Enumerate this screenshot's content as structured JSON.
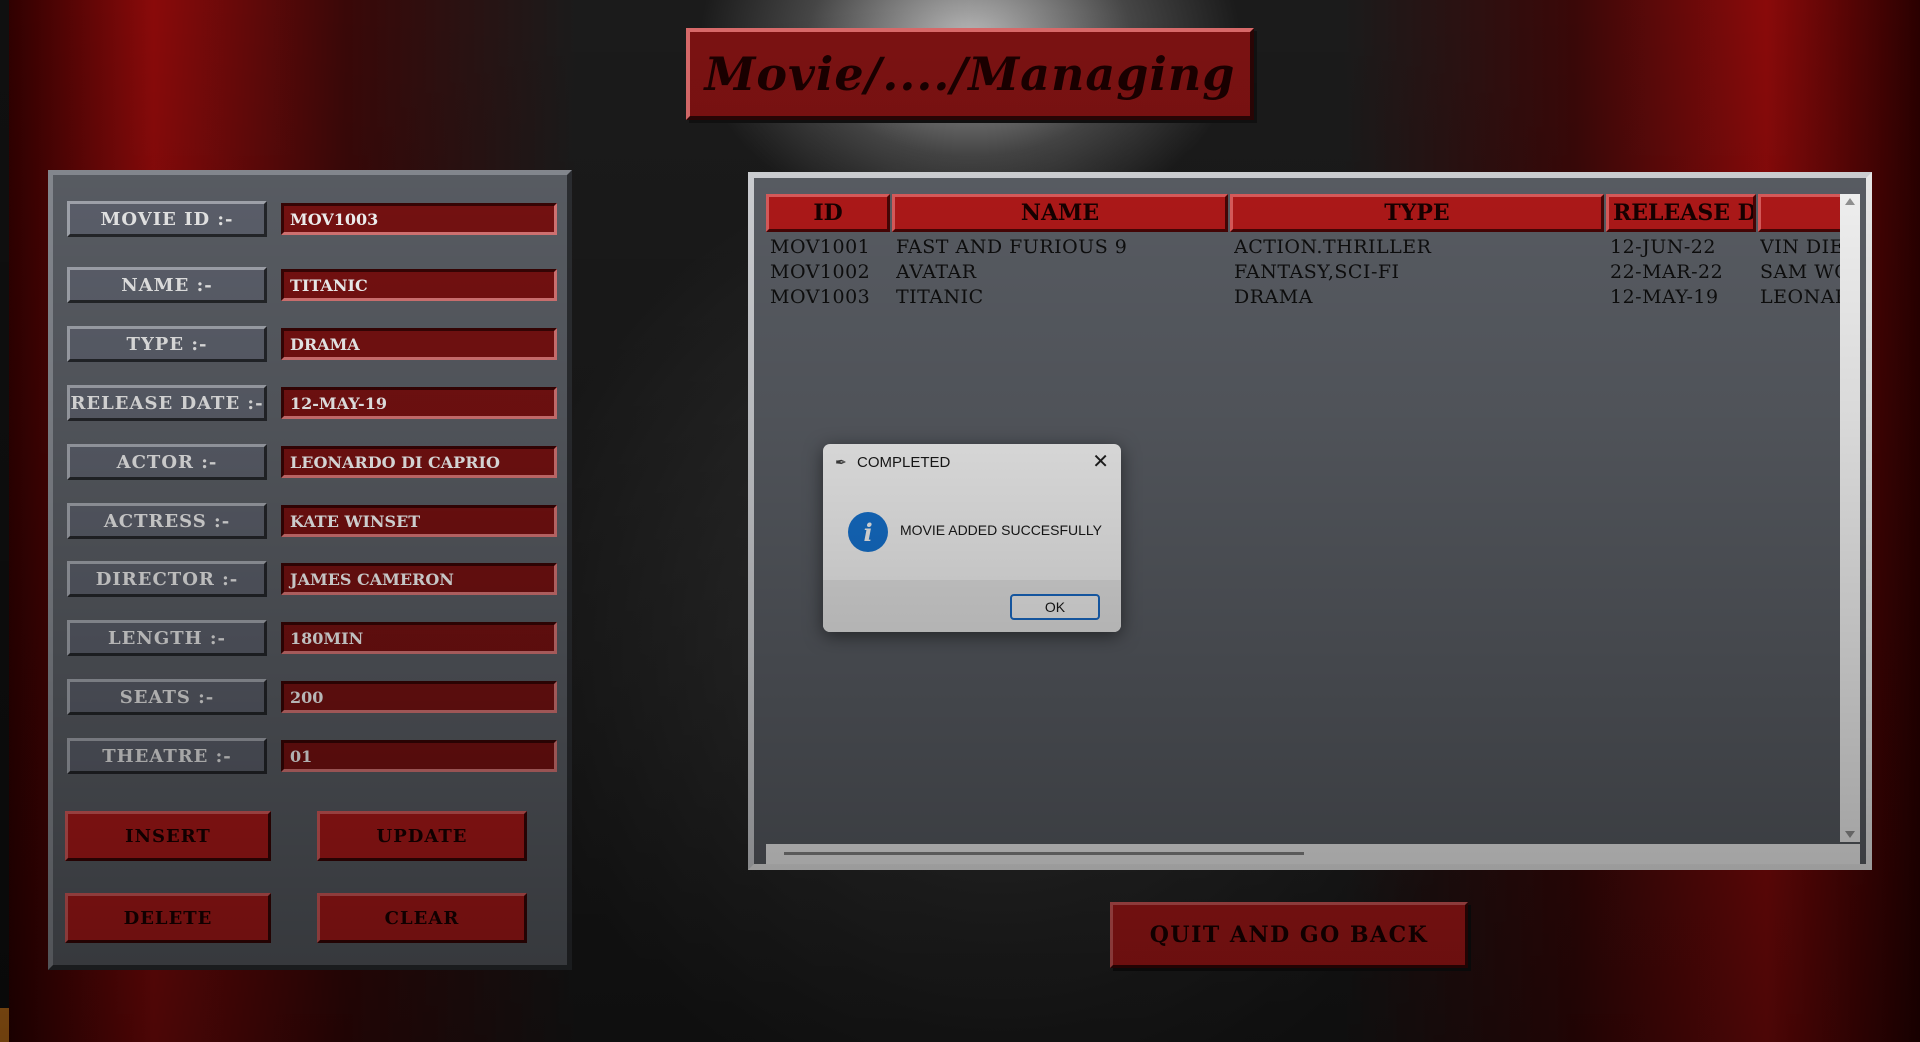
{
  "title": "Movie/..../Managing",
  "form": {
    "fields": [
      {
        "label": "MOVIE ID :-",
        "value": "MOV1003"
      },
      {
        "label": "NAME :-",
        "value": "TITANIC"
      },
      {
        "label": "TYPE :-",
        "value": "DRAMA"
      },
      {
        "label": "RELEASE DATE :-",
        "value": "12-MAY-19"
      },
      {
        "label": "ACTOR :-",
        "value": "LEONARDO DI CAPRIO"
      },
      {
        "label": "ACTRESS :-",
        "value": "KATE WINSET"
      },
      {
        "label": "DIRECTOR :-",
        "value": "JAMES CAMERON"
      },
      {
        "label": "LENGTH :-",
        "value": "180MIN"
      },
      {
        "label": "SEATS :-",
        "value": "200"
      },
      {
        "label": "THEATRE :-",
        "value": "01"
      }
    ],
    "buttons": {
      "insert": "INSERT",
      "update": "UPDATE",
      "delete": "DELETE",
      "clear": "CLEAR"
    }
  },
  "table": {
    "columns": [
      "ID",
      "NAME",
      "TYPE",
      "RELEASE D"
    ],
    "rows": [
      [
        "MOV1001",
        "FAST AND FURIOUS 9",
        "ACTION.THRILLER",
        "12-JUN-22",
        "VIN DIES"
      ],
      [
        "MOV1002",
        "AVATAR",
        "FANTASY,SCI-FI",
        "22-MAR-22",
        "SAM WO"
      ],
      [
        "MOV1003",
        "TITANIC",
        "DRAMA",
        "12-MAY-19",
        "LEONAR"
      ]
    ]
  },
  "quit_button": "QUIT AND GO BACK",
  "dialog": {
    "title": "COMPLETED",
    "message": "MOVIE ADDED SUCCESFULLY",
    "ok": "OK",
    "icon": "info-icon"
  },
  "colors": {
    "accent_red": "#b71a1a",
    "field_red": "#7c1212",
    "panel_gray": "#5d6168",
    "info_blue": "#1677d8"
  }
}
